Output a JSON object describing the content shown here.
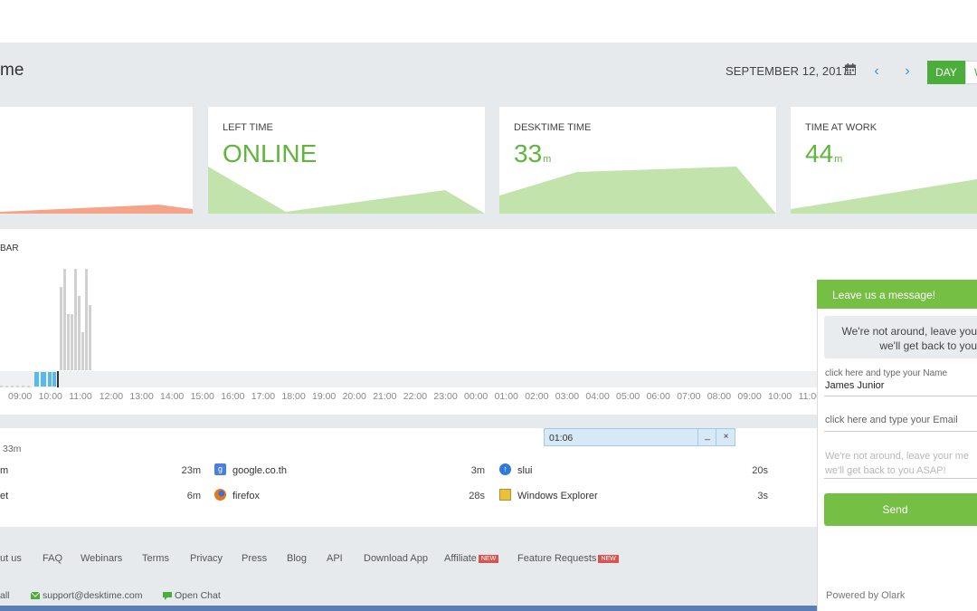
{
  "header": {
    "title": "me",
    "date": "SEPTEMBER 12, 2017",
    "calendar_icon": "calendar-icon",
    "prev_glyph": "‹",
    "next_glyph": "›",
    "day_label": "DAY",
    "week_label": "W"
  },
  "cards": [
    {
      "label": "LEFT TIME",
      "value": "ONLINE",
      "unit": ""
    },
    {
      "label": "DESKTIME TIME",
      "value": "33",
      "unit": "m"
    },
    {
      "label": "TIME AT WORK",
      "value": "44",
      "unit": "m"
    }
  ],
  "colors": {
    "accent": "#4cae3a",
    "chat_green": "#74bf44",
    "chart_green": "#c3e3ad",
    "chart_salmon": "#f5a48a"
  },
  "timeline": {
    "label": "BAR",
    "hours": [
      "09:00",
      "10:00",
      "11:00",
      "12:00",
      "13:00",
      "14:00",
      "15:00",
      "16:00",
      "17:00",
      "18:00",
      "19:00",
      "20:00",
      "21:00",
      "22:00",
      "23:00",
      "00:00",
      "01:00",
      "02:00",
      "03:00",
      "04:00",
      "05:00",
      "06:00",
      "07:00",
      "08:00",
      "09:00",
      "10:00",
      "11:00"
    ]
  },
  "apps": {
    "total": "33m",
    "rows": [
      [
        {
          "name": "m",
          "time": "23m"
        },
        {
          "name": "google.co.th",
          "time": "3m",
          "icon": "google-icon"
        },
        {
          "name": "slui",
          "time": "20s",
          "icon": "slui-icon"
        }
      ],
      [
        {
          "name": "et",
          "time": "6m"
        },
        {
          "name": "firefox",
          "time": "28s",
          "icon": "firefox-icon"
        },
        {
          "name": "Windows Explorer",
          "time": "3s",
          "icon": "windows-explorer-icon"
        }
      ]
    ]
  },
  "popup": {
    "time": "01:06",
    "minimize": "_",
    "close": "×"
  },
  "footer": {
    "links": [
      "ut us",
      "FAQ",
      "Webinars",
      "Terms",
      "Privacy",
      "Press",
      "Blog",
      "API",
      "Download App",
      "Affiliate",
      "Feature Requests"
    ],
    "new_badge": "NEW",
    "contacts": [
      "all",
      "support@desktime.com",
      "Open Chat"
    ]
  },
  "chat": {
    "title": "Leave us a message!",
    "notice_line1": "We're not around, leave you",
    "notice_line2": "we'll get back to you",
    "name_caption": "click here and type your Name",
    "name_value": "James Junior",
    "email_placeholder": "click here and type your Email",
    "message_placeholder_line1": "We're not around, leave your me",
    "message_placeholder_line2": "we'll get back to you ASAP!",
    "send_label": "Send",
    "powered_by": "Powered by Olark"
  }
}
